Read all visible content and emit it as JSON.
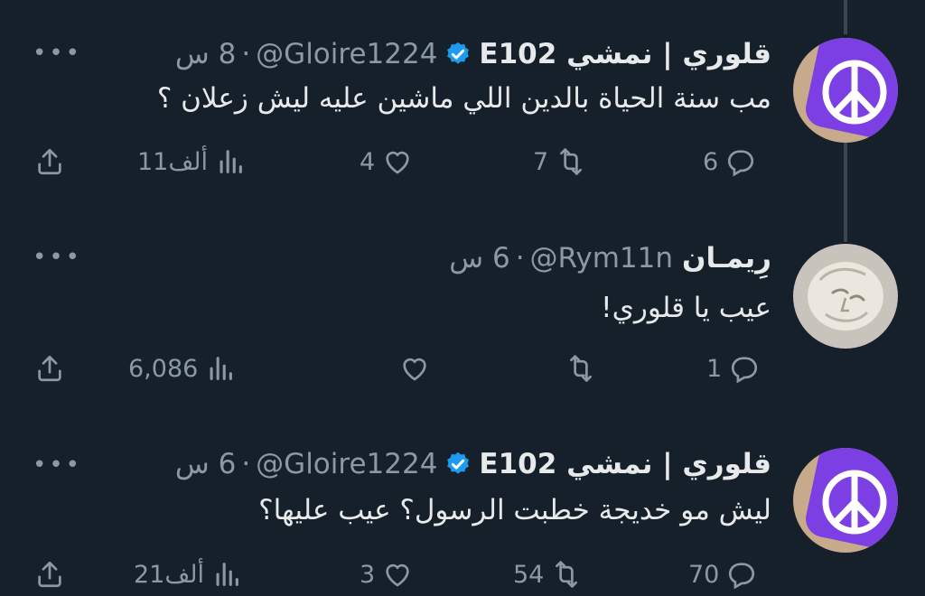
{
  "tweets": [
    {
      "display_name": "قلوري | نمشي E102",
      "handle": "@Gloire1224",
      "time": "8 س",
      "verified": true,
      "text": "مب سنة الحياة بالدين اللي ماشين عليه ليش زعلان ؟",
      "replies": "6",
      "retweets": "7",
      "likes": "4",
      "views": "11ألف",
      "avatar": "peace-sign-purple"
    },
    {
      "display_name": "رِيمـان",
      "handle": "@Rym11n",
      "time": "6 س",
      "verified": false,
      "text": "عيب يا قلوري!",
      "replies": "1",
      "retweets": "",
      "likes": "",
      "views": "6,086",
      "avatar": "sculpture-face"
    },
    {
      "display_name": "قلوري | نمشي E102",
      "handle": "@Gloire1224",
      "time": "6 س",
      "verified": true,
      "text": "ليش مو خديجة خطبت الرسول؟ عيب عليها؟",
      "replies": "70",
      "retweets": "54",
      "likes": "3",
      "views": "21ألف",
      "avatar": "peace-sign-purple"
    }
  ],
  "dot": "·",
  "more_label": "•••",
  "colors": {
    "background": "#15202b",
    "text": "#e7e9ea",
    "muted": "#8b98a5",
    "verified": "#1d9bf0",
    "avatar_purple": "#7b3fe4"
  }
}
